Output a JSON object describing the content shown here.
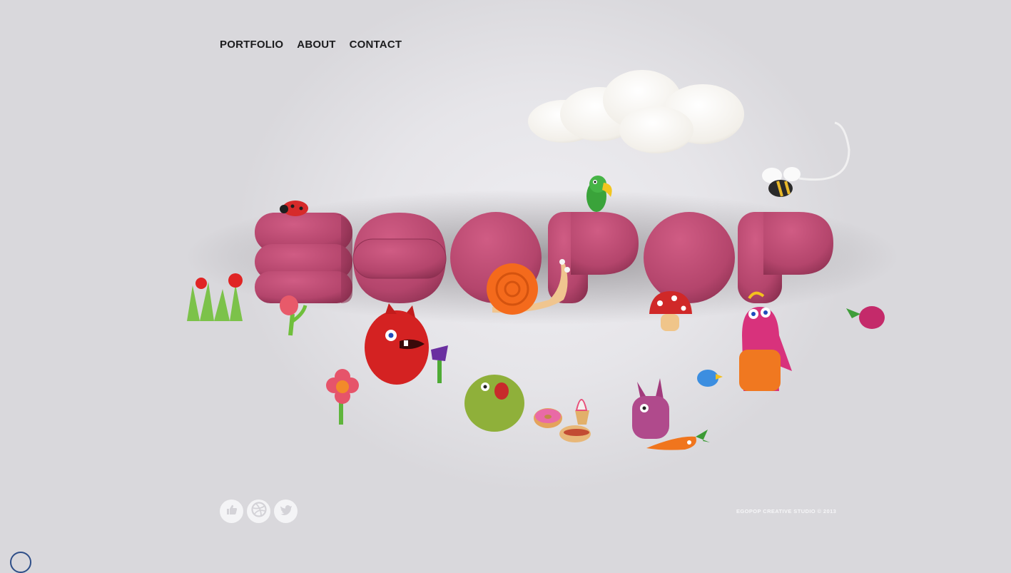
{
  "nav": {
    "items": [
      {
        "label": "PORTFOLIO"
      },
      {
        "label": "ABOUT"
      },
      {
        "label": "CONTACT"
      }
    ]
  },
  "logo": {
    "text": "EGOPOP",
    "color": "#b8486f"
  },
  "social": {
    "items": [
      {
        "icon": "thumbs-up-icon"
      },
      {
        "icon": "dribbble-icon"
      },
      {
        "icon": "twitter-icon"
      }
    ]
  },
  "footer": {
    "text": "EGOPOP CREATIVE STUDIO  ©  2013"
  }
}
